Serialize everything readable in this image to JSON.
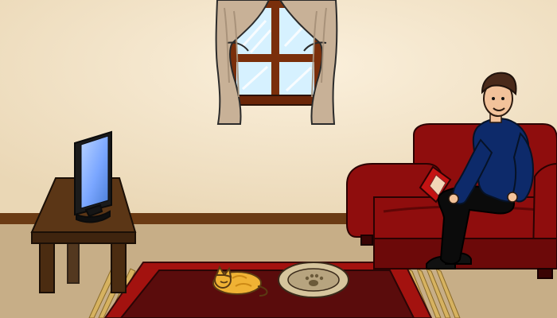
{
  "scene": {
    "name": "living-room",
    "objects": [
      "window",
      "curtains",
      "tv",
      "tv-table",
      "sofa",
      "man",
      "red-book",
      "rug",
      "sleeping-cat",
      "pet-bed"
    ]
  },
  "colors": {
    "wall_light": "#f7ead3",
    "wall_shadow": "#e9d6b6",
    "floor": "#c7ae87",
    "baseboard": "#6b3b14",
    "rug_border": "#a3120f",
    "rug_inner": "#5a0c0c",
    "rug_fringe": "#d6b260",
    "sofa_red": "#8f0d0d",
    "sofa_dark": "#6c0909",
    "table_brown": "#5b3616",
    "tv_black": "#1b1b1b",
    "tv_screen": "#7aa6ff",
    "curtain": "#c8b197",
    "window_frame": "#7a2f0b",
    "glass": "#d6f1ff",
    "shirt_navy": "#0d2a6a",
    "pants_black": "#0b0b0b",
    "skin": "#f2c29a",
    "cat_orange": "#f0b234",
    "pet_bed": "#d6c59d"
  }
}
